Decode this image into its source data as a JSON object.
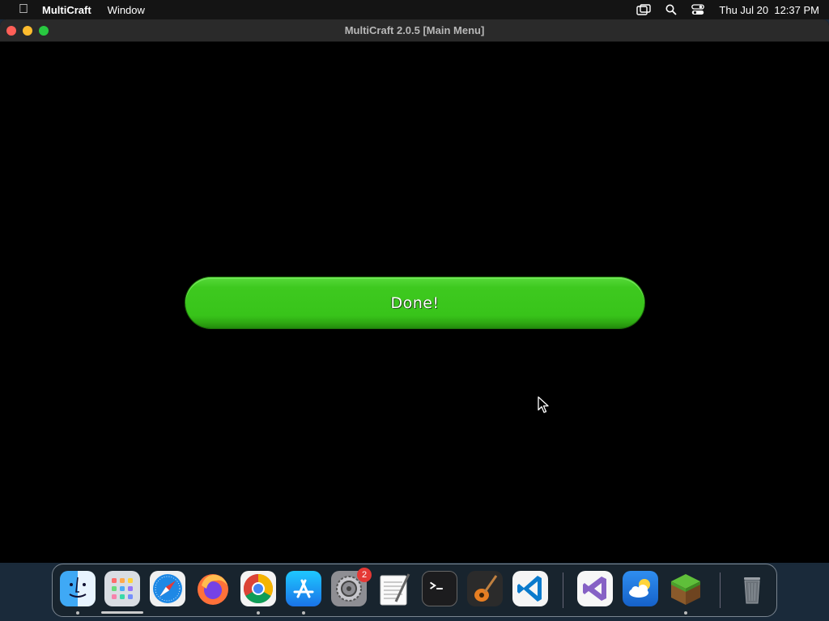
{
  "menubar": {
    "app_name": "MultiCraft",
    "items": [
      "Window"
    ],
    "datetime": "Thu Jul 20  12:37 PM"
  },
  "window": {
    "title": "MultiCraft 2.0.5 [Main Menu]"
  },
  "game": {
    "done_label": "Done!",
    "button_color": "#3ec91f"
  },
  "dock": {
    "apps": [
      {
        "name": "finder-icon"
      },
      {
        "name": "launchpad-icon"
      },
      {
        "name": "safari-icon"
      },
      {
        "name": "firefox-icon"
      },
      {
        "name": "chrome-icon"
      },
      {
        "name": "app-store-icon"
      },
      {
        "name": "system-settings-icon",
        "badge": "2"
      },
      {
        "name": "textedit-icon"
      },
      {
        "name": "terminal-icon"
      },
      {
        "name": "garageband-icon"
      },
      {
        "name": "vscode-icon"
      },
      {
        "name": "visual-studio-icon"
      },
      {
        "name": "weather-icon"
      },
      {
        "name": "multicraft-icon"
      },
      {
        "name": "trash-icon"
      }
    ]
  }
}
